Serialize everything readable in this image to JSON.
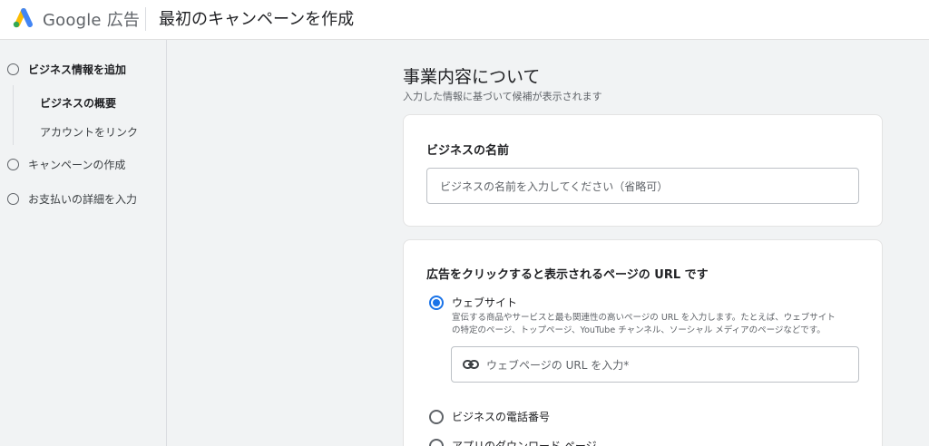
{
  "header": {
    "brand": "Google",
    "brand_suffix": "広告",
    "title": "最初のキャンペーンを作成"
  },
  "sidebar": {
    "steps": [
      {
        "label": "ビジネス情報を追加",
        "state": "current"
      },
      {
        "label": "キャンペーンの作成",
        "state": "pending"
      },
      {
        "label": "お支払いの詳細を入力",
        "state": "pending"
      }
    ],
    "substeps": [
      {
        "label": "ビジネスの概要",
        "active": true
      },
      {
        "label": "アカウントをリンク",
        "active": false
      }
    ]
  },
  "main": {
    "title": "事業内容について",
    "subtitle": "入力した情報に基づいて候補が表示されます",
    "business_name": {
      "label": "ビジネスの名前",
      "placeholder": "ビジネスの名前を入力してください（省略可）"
    },
    "destination": {
      "label": "広告をクリックすると表示されるページの URL です",
      "options": [
        {
          "label": "ウェブサイト",
          "selected": true,
          "description_line1": "宣伝する商品やサービスと最も関連性の高いページの URL を入力します。たとえば、ウェブサイト",
          "description_line2": "の特定のページ、トップページ、YouTube チャンネル、ソーシャル メディアのページなどです。"
        },
        {
          "label": "ビジネスの電話番号",
          "selected": false
        },
        {
          "label": "アプリのダウンロード ページ",
          "selected": false
        }
      ],
      "url_placeholder": "ウェブページの URL を入力*"
    }
  },
  "colors": {
    "accent": "#1a73e8",
    "background": "#f1f3f4",
    "card": "#ffffff"
  },
  "icons": {
    "logo": "google-ads-logo",
    "link": "link-icon"
  }
}
